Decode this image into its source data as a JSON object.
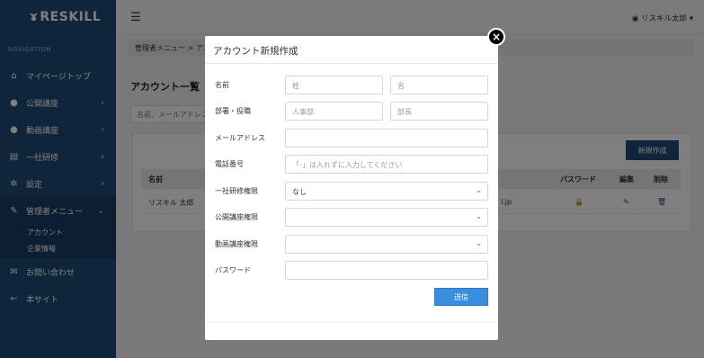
{
  "brand": {
    "logo_text": "RESKILL",
    "logo_mark": "ɤ"
  },
  "sidebar": {
    "nav_title": "NAVIGATION",
    "items": [
      {
        "label": "マイページトップ",
        "icon": "home-icon",
        "glyph": "⌂"
      },
      {
        "label": "公開講座",
        "icon": "user-icon",
        "glyph": "●",
        "chevron": "›"
      },
      {
        "label": "動画講座",
        "icon": "user-icon",
        "glyph": "●",
        "chevron": "›"
      },
      {
        "label": "一社研修",
        "icon": "document-icon",
        "glyph": "▤",
        "chevron": "›"
      },
      {
        "label": "設定",
        "icon": "gear-icon",
        "glyph": "✲",
        "chevron": "›"
      },
      {
        "label": "管理者メニュー",
        "icon": "wrench-icon",
        "glyph": "✎",
        "chevron": "⌄"
      }
    ],
    "sub_items": [
      {
        "label": "アカウント"
      },
      {
        "label": "企業情報"
      }
    ],
    "bottom_items": [
      {
        "label": "お問い合わせ",
        "icon": "chat-icon",
        "glyph": "✉"
      },
      {
        "label": "本サイト",
        "icon": "arrow-left-icon",
        "glyph": "←"
      }
    ]
  },
  "header": {
    "hamburger": "☰",
    "user": "リスキル太郎",
    "user_caret": "▾",
    "user_glyph": "◉"
  },
  "main": {
    "breadcrumb": "管理者メニュー > アカ",
    "heading": "アカウント一覧",
    "search_placeholder": "名前、メールアドレス",
    "new_button": "新規作成",
    "columns": {
      "name": "名前",
      "password": "パスワード",
      "edit": "編集",
      "delete": "削除"
    },
    "row": {
      "name": "リスキル 太郎",
      "email_tail": "l.jp",
      "lock": "🔒",
      "edit_icon": "✎",
      "delete_icon": "🗑"
    }
  },
  "modal": {
    "title": "アカウント新規作成",
    "close": "×",
    "labels": {
      "name": "名前",
      "department": "部署・役職",
      "email": "メールアドレス",
      "phone": "電話番号",
      "corp_training": "一社研修権限",
      "public_course": "公開講座権限",
      "video_course": "動画講座権限",
      "password": "パスワード"
    },
    "fields": {
      "last_name_placeholder": "姓",
      "first_name_placeholder": "名",
      "department_placeholder": "人事部",
      "position_placeholder": "部長",
      "email_value": "",
      "phone_placeholder": "「-」は入れずに入力してください",
      "corp_training_value": "なし",
      "public_course_value": "",
      "video_course_value": "",
      "password_value": ""
    },
    "caret": "⌄",
    "submit": "送信"
  }
}
